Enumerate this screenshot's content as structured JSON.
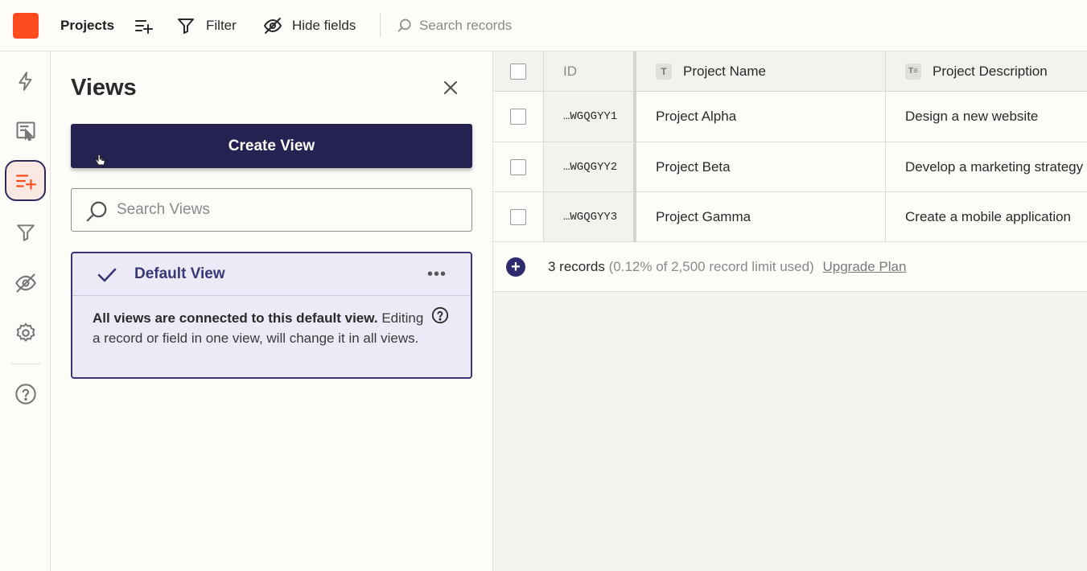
{
  "topbar": {
    "title": "Projects",
    "filter_label": "Filter",
    "hide_fields_label": "Hide fields",
    "search_placeholder": "Search records"
  },
  "rail": {
    "items": [
      "bolt-icon",
      "form-icon",
      "views-icon",
      "filter-icon",
      "hide-icon",
      "settings-icon",
      "help-icon"
    ],
    "active": "views-icon"
  },
  "views_panel": {
    "title": "Views",
    "create_label": "Create View",
    "search_placeholder": "Search Views",
    "default_view": {
      "name": "Default View",
      "more": "•••",
      "info_bold": "All views are connected to this default view.",
      "info_text": "Editing a record or field in one view, will change it in all views."
    }
  },
  "table": {
    "headers": {
      "id": "ID",
      "name": "Project Name",
      "description": "Project Description",
      "name_type": "T",
      "description_type": "T≡"
    },
    "rows": [
      {
        "id": "…WGQGYY1",
        "name": "Project Alpha",
        "description": "Design a new website"
      },
      {
        "id": "…WGQGYY2",
        "name": "Project Beta",
        "description": "Develop a marketing strategy"
      },
      {
        "id": "…WGQGYY3",
        "name": "Project Gamma",
        "description": "Create a mobile application"
      }
    ],
    "footer": {
      "add": "+",
      "count": "3 records",
      "limit": "(0.12% of 2,500 record limit used)",
      "upgrade": "Upgrade Plan"
    }
  },
  "colors": {
    "brand": "#ff4b1f",
    "primary": "#252150",
    "accent": "#3a3778"
  }
}
